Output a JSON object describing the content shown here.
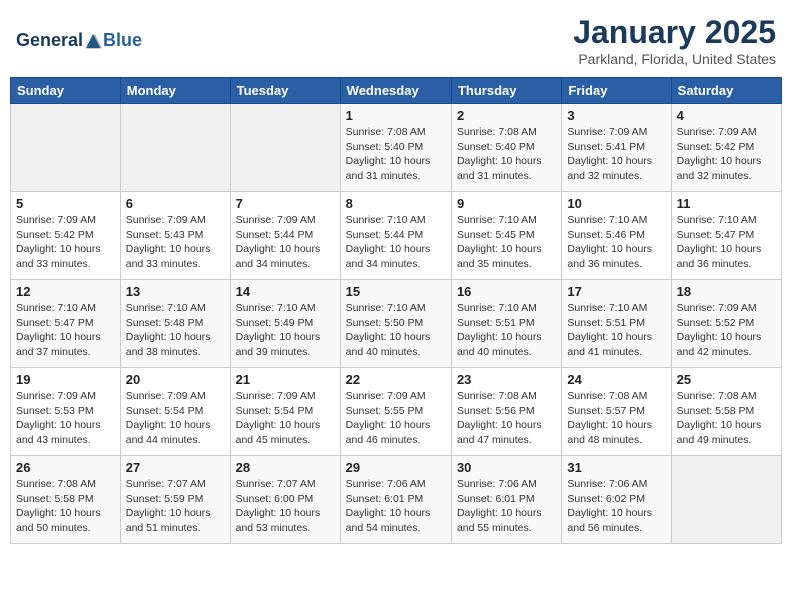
{
  "header": {
    "logo_general": "General",
    "logo_blue": "Blue",
    "month": "January 2025",
    "location": "Parkland, Florida, United States"
  },
  "days_of_week": [
    "Sunday",
    "Monday",
    "Tuesday",
    "Wednesday",
    "Thursday",
    "Friday",
    "Saturday"
  ],
  "weeks": [
    [
      {
        "num": "",
        "info": ""
      },
      {
        "num": "",
        "info": ""
      },
      {
        "num": "",
        "info": ""
      },
      {
        "num": "1",
        "info": "Sunrise: 7:08 AM\nSunset: 5:40 PM\nDaylight: 10 hours\nand 31 minutes."
      },
      {
        "num": "2",
        "info": "Sunrise: 7:08 AM\nSunset: 5:40 PM\nDaylight: 10 hours\nand 31 minutes."
      },
      {
        "num": "3",
        "info": "Sunrise: 7:09 AM\nSunset: 5:41 PM\nDaylight: 10 hours\nand 32 minutes."
      },
      {
        "num": "4",
        "info": "Sunrise: 7:09 AM\nSunset: 5:42 PM\nDaylight: 10 hours\nand 32 minutes."
      }
    ],
    [
      {
        "num": "5",
        "info": "Sunrise: 7:09 AM\nSunset: 5:42 PM\nDaylight: 10 hours\nand 33 minutes."
      },
      {
        "num": "6",
        "info": "Sunrise: 7:09 AM\nSunset: 5:43 PM\nDaylight: 10 hours\nand 33 minutes."
      },
      {
        "num": "7",
        "info": "Sunrise: 7:09 AM\nSunset: 5:44 PM\nDaylight: 10 hours\nand 34 minutes."
      },
      {
        "num": "8",
        "info": "Sunrise: 7:10 AM\nSunset: 5:44 PM\nDaylight: 10 hours\nand 34 minutes."
      },
      {
        "num": "9",
        "info": "Sunrise: 7:10 AM\nSunset: 5:45 PM\nDaylight: 10 hours\nand 35 minutes."
      },
      {
        "num": "10",
        "info": "Sunrise: 7:10 AM\nSunset: 5:46 PM\nDaylight: 10 hours\nand 36 minutes."
      },
      {
        "num": "11",
        "info": "Sunrise: 7:10 AM\nSunset: 5:47 PM\nDaylight: 10 hours\nand 36 minutes."
      }
    ],
    [
      {
        "num": "12",
        "info": "Sunrise: 7:10 AM\nSunset: 5:47 PM\nDaylight: 10 hours\nand 37 minutes."
      },
      {
        "num": "13",
        "info": "Sunrise: 7:10 AM\nSunset: 5:48 PM\nDaylight: 10 hours\nand 38 minutes."
      },
      {
        "num": "14",
        "info": "Sunrise: 7:10 AM\nSunset: 5:49 PM\nDaylight: 10 hours\nand 39 minutes."
      },
      {
        "num": "15",
        "info": "Sunrise: 7:10 AM\nSunset: 5:50 PM\nDaylight: 10 hours\nand 40 minutes."
      },
      {
        "num": "16",
        "info": "Sunrise: 7:10 AM\nSunset: 5:51 PM\nDaylight: 10 hours\nand 40 minutes."
      },
      {
        "num": "17",
        "info": "Sunrise: 7:10 AM\nSunset: 5:51 PM\nDaylight: 10 hours\nand 41 minutes."
      },
      {
        "num": "18",
        "info": "Sunrise: 7:09 AM\nSunset: 5:52 PM\nDaylight: 10 hours\nand 42 minutes."
      }
    ],
    [
      {
        "num": "19",
        "info": "Sunrise: 7:09 AM\nSunset: 5:53 PM\nDaylight: 10 hours\nand 43 minutes."
      },
      {
        "num": "20",
        "info": "Sunrise: 7:09 AM\nSunset: 5:54 PM\nDaylight: 10 hours\nand 44 minutes."
      },
      {
        "num": "21",
        "info": "Sunrise: 7:09 AM\nSunset: 5:54 PM\nDaylight: 10 hours\nand 45 minutes."
      },
      {
        "num": "22",
        "info": "Sunrise: 7:09 AM\nSunset: 5:55 PM\nDaylight: 10 hours\nand 46 minutes."
      },
      {
        "num": "23",
        "info": "Sunrise: 7:08 AM\nSunset: 5:56 PM\nDaylight: 10 hours\nand 47 minutes."
      },
      {
        "num": "24",
        "info": "Sunrise: 7:08 AM\nSunset: 5:57 PM\nDaylight: 10 hours\nand 48 minutes."
      },
      {
        "num": "25",
        "info": "Sunrise: 7:08 AM\nSunset: 5:58 PM\nDaylight: 10 hours\nand 49 minutes."
      }
    ],
    [
      {
        "num": "26",
        "info": "Sunrise: 7:08 AM\nSunset: 5:58 PM\nDaylight: 10 hours\nand 50 minutes."
      },
      {
        "num": "27",
        "info": "Sunrise: 7:07 AM\nSunset: 5:59 PM\nDaylight: 10 hours\nand 51 minutes."
      },
      {
        "num": "28",
        "info": "Sunrise: 7:07 AM\nSunset: 6:00 PM\nDaylight: 10 hours\nand 53 minutes."
      },
      {
        "num": "29",
        "info": "Sunrise: 7:06 AM\nSunset: 6:01 PM\nDaylight: 10 hours\nand 54 minutes."
      },
      {
        "num": "30",
        "info": "Sunrise: 7:06 AM\nSunset: 6:01 PM\nDaylight: 10 hours\nand 55 minutes."
      },
      {
        "num": "31",
        "info": "Sunrise: 7:06 AM\nSunset: 6:02 PM\nDaylight: 10 hours\nand 56 minutes."
      },
      {
        "num": "",
        "info": ""
      }
    ]
  ]
}
